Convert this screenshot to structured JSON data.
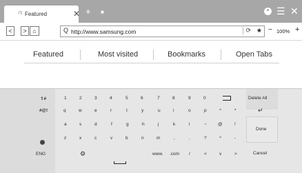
{
  "tab": {
    "label": "Featured",
    "icon": "lock-icon"
  },
  "window": {
    "menu_icon": "hamburger-icon",
    "close_icon": "close-icon"
  },
  "address": {
    "url": "http://www.samsung.com",
    "zoom": "100%"
  },
  "content_tabs": [
    "Featured",
    "Most visited",
    "Bookmarks",
    "Open Tabs"
  ],
  "keyboard": {
    "row1": [
      "1",
      "2",
      "3",
      "4",
      "5",
      "6",
      "7",
      "8",
      "9",
      "0"
    ],
    "row2_label": "#@!",
    "row2": [
      "q",
      "w",
      "e",
      "r",
      "t",
      "y",
      "u",
      "i",
      "o",
      "p",
      "^",
      "*"
    ],
    "row3": [
      "a",
      "s",
      "d",
      "f",
      "g",
      "h",
      "j",
      "k",
      "l",
      "~",
      "@",
      "!"
    ],
    "row4": [
      "z",
      "x",
      "c",
      "v",
      "b",
      "n",
      "m",
      ",",
      ".",
      "?",
      "^",
      "-"
    ],
    "row5": [
      "www.",
      ".com",
      "/",
      "<",
      "v",
      ">"
    ],
    "lang": "ENG",
    "delete_all": "Delete All",
    "done": "Done",
    "cancel": "Cancel"
  }
}
